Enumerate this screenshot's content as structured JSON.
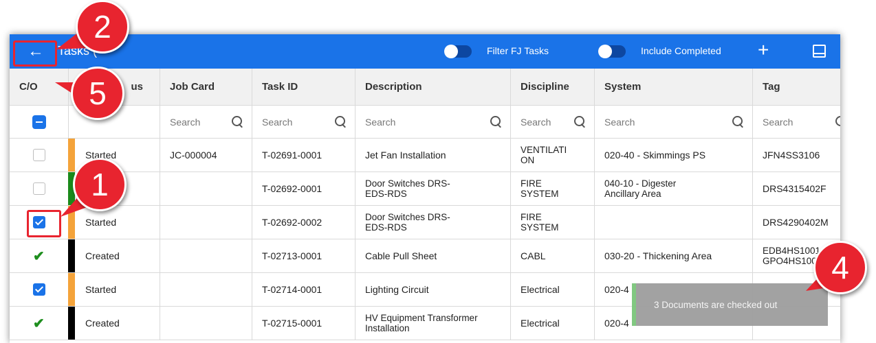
{
  "toolbar": {
    "back_icon": "arrow-left-icon",
    "title": "Tasks (",
    "filter_fj_label": "Filter FJ Tasks",
    "include_completed_label": "Include Completed",
    "add_icon": "plus-icon",
    "panel_icon": "panel-icon",
    "color": "#1a73e8"
  },
  "columns": {
    "co": "C/O",
    "status": "us",
    "job_card": "Job Card",
    "task_id": "Task ID",
    "description": "Description",
    "discipline": "Discipline",
    "system": "System",
    "tag": "Tag"
  },
  "search_placeholder": "Search",
  "rows": [
    {
      "check": "empty",
      "status": "Started",
      "status_color": "#f4a33a",
      "job_card": "JC-000004",
      "task_id": "T-02691-0001",
      "description": "Jet Fan Installation",
      "discipline": "VENTILATI\nON",
      "system": "020-40 - Skimmings PS",
      "tag": "JFN4SS3106"
    },
    {
      "check": "empty",
      "status": "d",
      "status_color": "#1b8a1b",
      "job_card": "",
      "task_id": "T-02692-0001",
      "description": "Door Switches DRS-\nEDS-RDS",
      "discipline": "FIRE\nSYSTEM",
      "system": "040-10 - Digester\nAncillary Area",
      "tag": "DRS4315402F"
    },
    {
      "check": "checked",
      "status": "Started",
      "status_color": "#f4a33a",
      "job_card": "",
      "task_id": "T-02692-0002",
      "description": "Door Switches DRS-\nEDS-RDS",
      "discipline": "FIRE\nSYSTEM",
      "system": "",
      "tag": "DRS4290402M"
    },
    {
      "check": "done",
      "status": "Created",
      "status_color": "#000000",
      "job_card": "",
      "task_id": "T-02713-0001",
      "description": "Cable Pull Sheet",
      "discipline": "CABL",
      "system": "030-20 - Thickening Area",
      "tag": "EDB4HS1001\nGPO4HS100"
    },
    {
      "check": "checked",
      "status": "Started",
      "status_color": "#f4a33a",
      "job_card": "",
      "task_id": "T-02714-0001",
      "description": "Lighting Circuit",
      "discipline": "Electrical",
      "system": "020-4",
      "tag": ""
    },
    {
      "check": "done",
      "status": "Created",
      "status_color": "#000000",
      "job_card": "",
      "task_id": "T-02715-0001",
      "description": "HV Equipment Transformer\nInstallation",
      "discipline": "Electrical",
      "system": "020-4",
      "tag": ""
    }
  ],
  "toast": {
    "message": "3 Documents are checked out"
  },
  "callouts": {
    "c1": "1",
    "c2": "2",
    "c4": "4",
    "c5": "5"
  },
  "callout_color": "#e8242f"
}
